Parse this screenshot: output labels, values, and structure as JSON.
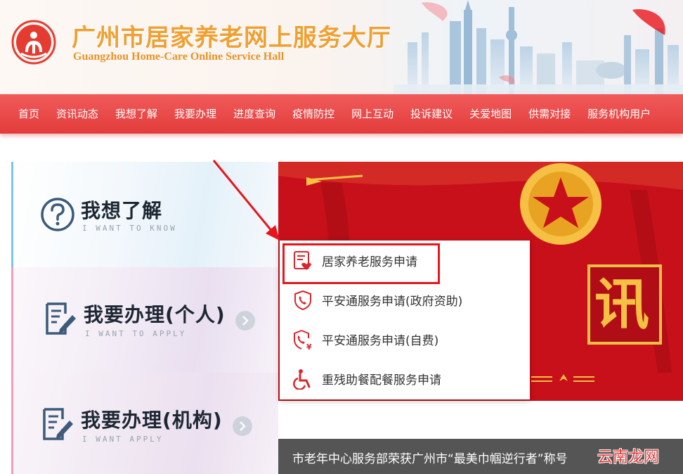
{
  "header": {
    "title": "广州市居家养老网上服务大厅",
    "subtitle": "Guangzhou Home-Care Online Service Hall"
  },
  "nav": {
    "items": [
      "首页",
      "资讯动态",
      "我想了解",
      "我要办理",
      "进度查询",
      "疫情防控",
      "网上互动",
      "投诉建议",
      "关爱地图",
      "供需对接",
      "服务机构用户"
    ]
  },
  "cards": {
    "know": {
      "title": "我想了解",
      "sub": "I WANT TO KNOW"
    },
    "apply_personal": {
      "title": "我要办理",
      "title_suffix": "(个人)",
      "sub": "I WANT TO APPLY"
    },
    "apply_org": {
      "title": "我要办理",
      "title_suffix": "(机构)",
      "sub": "I WANT APPLY"
    }
  },
  "dropdown": {
    "items": [
      {
        "label": "居家养老服务申请",
        "icon": "document-heart-icon"
      },
      {
        "label": "平安通服务申请(政府资助)",
        "icon": "shield-phone-icon"
      },
      {
        "label": "平安通服务申请(自费)",
        "icon": "shield-phone-yen-icon"
      },
      {
        "label": "重残助餐配餐服务申请",
        "icon": "wheelchair-icon"
      }
    ]
  },
  "banner": {
    "character": "讯",
    "caption": "市老年中心服务部荣获广州市“最美巾帼逆行者”称号",
    "watermark": "云南龙网"
  },
  "colors": {
    "accent": "#e33b3b",
    "title_gold": "#f0a032",
    "banner_red": "#c8101a"
  }
}
